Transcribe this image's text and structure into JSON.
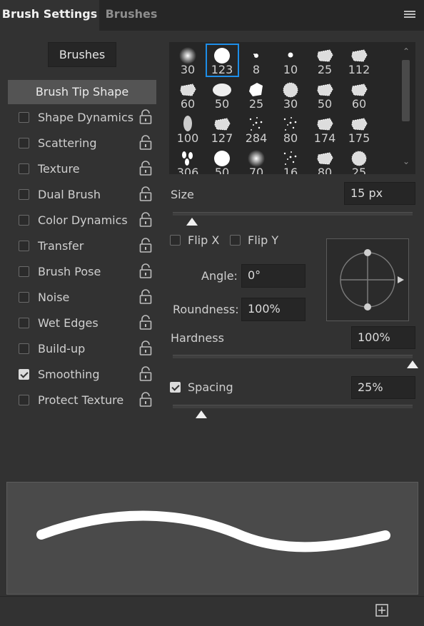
{
  "header": {
    "tabs": [
      {
        "label": "Brush Settings",
        "active": true
      },
      {
        "label": "Brushes",
        "active": false
      }
    ],
    "menu_icon": "panel-menu-icon"
  },
  "left": {
    "brushes_button": "Brushes",
    "brush_tip_shape": "Brush Tip Shape",
    "options": [
      {
        "label": "Shape Dynamics",
        "checked": false
      },
      {
        "label": "Scattering",
        "checked": false
      },
      {
        "label": "Texture",
        "checked": false
      },
      {
        "label": "Dual Brush",
        "checked": false
      },
      {
        "label": "Color Dynamics",
        "checked": false
      },
      {
        "label": "Transfer",
        "checked": false
      },
      {
        "label": "Brush Pose",
        "checked": false
      },
      {
        "label": "Noise",
        "checked": false
      },
      {
        "label": "Wet Edges",
        "checked": false
      },
      {
        "label": "Build-up",
        "checked": false
      },
      {
        "label": "Smoothing",
        "checked": true
      },
      {
        "label": "Protect Texture",
        "checked": false
      }
    ]
  },
  "presets": {
    "selected_index": 1,
    "items": [
      {
        "size": "30",
        "kind": "soft"
      },
      {
        "size": "123",
        "kind": "hard"
      },
      {
        "size": "8",
        "kind": "splat"
      },
      {
        "size": "10",
        "kind": "dot"
      },
      {
        "size": "25",
        "kind": "texture"
      },
      {
        "size": "112",
        "kind": "texture"
      },
      {
        "size": "60",
        "kind": "texture"
      },
      {
        "size": "50",
        "kind": "oval"
      },
      {
        "size": "25",
        "kind": "rock"
      },
      {
        "size": "30",
        "kind": "fuzzy"
      },
      {
        "size": "50",
        "kind": "texture"
      },
      {
        "size": "60",
        "kind": "texture"
      },
      {
        "size": "100",
        "kind": "drop"
      },
      {
        "size": "127",
        "kind": "texture"
      },
      {
        "size": "284",
        "kind": "spatter"
      },
      {
        "size": "80",
        "kind": "spatter"
      },
      {
        "size": "174",
        "kind": "texture"
      },
      {
        "size": "175",
        "kind": "texture"
      },
      {
        "size": "306",
        "kind": "leaves"
      },
      {
        "size": "50",
        "kind": "hard"
      },
      {
        "size": "70",
        "kind": "soft"
      },
      {
        "size": "16",
        "kind": "spatter"
      },
      {
        "size": "80",
        "kind": "texture"
      },
      {
        "size": "25",
        "kind": "fuzzy"
      }
    ]
  },
  "controls": {
    "size_label": "Size",
    "size_value": "15 px",
    "size_slider": 0.08,
    "flip_x": "Flip X",
    "flip_y": "Flip Y",
    "angle_label": "Angle:",
    "angle_value": "0°",
    "roundness_label": "Roundness:",
    "roundness_value": "100%",
    "hardness_label": "Hardness",
    "hardness_value": "100%",
    "hardness_slider": 1.0,
    "spacing_label": "Spacing",
    "spacing_checked": true,
    "spacing_value": "25%",
    "spacing_slider": 0.12
  },
  "footer": {
    "new_preset_icon": "new-preset-icon"
  }
}
